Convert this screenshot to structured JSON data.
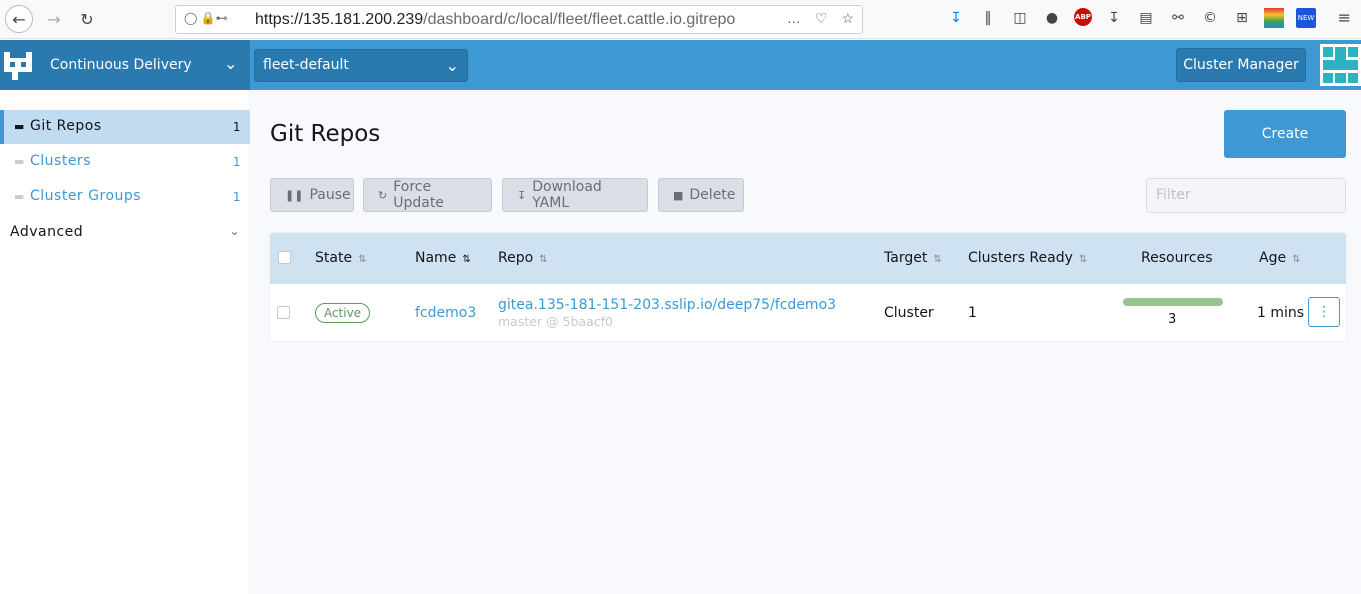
{
  "browser": {
    "url_host": "https://135.181.200.239",
    "url_path": "/dashboard/c/local/fleet/fleet.cattle.io.gitrepo",
    "new_badge": "NEW",
    "abp_label": "ABP"
  },
  "header": {
    "app_name": "Continuous Delivery",
    "workspace": "fleet-default",
    "cluster_manager_label": "Cluster Manager"
  },
  "sidebar": {
    "items": [
      {
        "label": "Git Repos",
        "count": "1"
      },
      {
        "label": "Clusters",
        "count": "1"
      },
      {
        "label": "Cluster Groups",
        "count": "1"
      }
    ],
    "group_label": "Advanced"
  },
  "main": {
    "title": "Git Repos",
    "create_label": "Create",
    "bulk_actions": {
      "pause": "Pause",
      "force_update": "Force Update",
      "download_yaml": "Download YAML",
      "delete": "Delete"
    },
    "filter_placeholder": "Filter",
    "table": {
      "headers": {
        "state": "State",
        "name": "Name",
        "repo": "Repo",
        "target": "Target",
        "clusters_ready": "Clusters Ready",
        "resources": "Resources",
        "age": "Age"
      },
      "rows": [
        {
          "state": "Active",
          "name": "fcdemo3",
          "repo": "gitea.135-181-151-203.sslip.io/deep75/fcdemo3",
          "commit": "master @ 5baacf0",
          "target": "Cluster",
          "clusters_ready": "1",
          "resources": "3",
          "age": "1 mins"
        }
      ]
    }
  },
  "colors": {
    "accent": "#3d98d3",
    "header_dark": "#2a7ab0",
    "active_green": "#5d995d",
    "resource_bar": "#99c391"
  }
}
